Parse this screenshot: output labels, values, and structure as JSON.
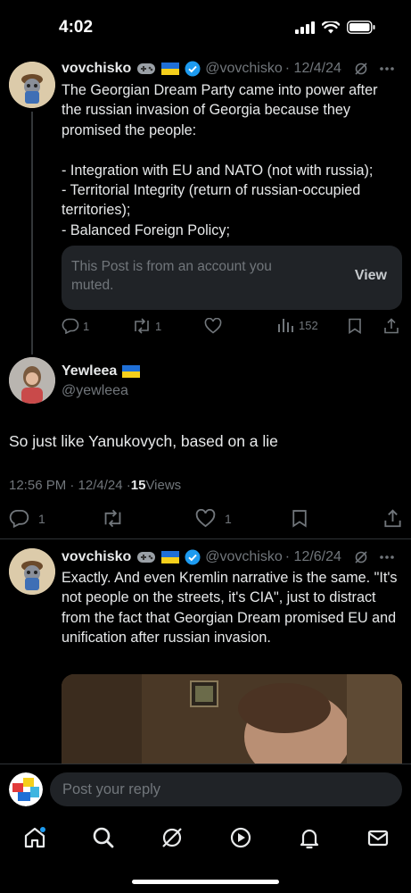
{
  "status_bar": {
    "time": "4:02"
  },
  "tweets": [
    {
      "name": "vovchisko",
      "handle": "@vovchisko",
      "date": "· 12/4/24",
      "body": "The Georgian Dream Party came into power after the russian invasion of Georgia because they promised the people:\n\n- Integration with EU and NATO (not with russia);\n- Territorial Integrity (return of russian-occupied territories);\n- Balanced Foreign Policy;",
      "muted_notice": "This Post is from an account you muted.",
      "muted_view": "View",
      "replies": "1",
      "reposts": "1",
      "views": "152"
    },
    {
      "name": "Yewleea",
      "handle": "@yewleea",
      "body": "So just like Yanukovych, based on a lie",
      "timestamp": "12:56 PM · 12/4/24 · ",
      "views_count": "15",
      "views_label": " Views",
      "replies": "1",
      "likes": "1"
    },
    {
      "name": "vovchisko",
      "handle": "@vovchisko",
      "date": "· 12/6/24",
      "body": "Exactly. And even Kremlin narrative is the same. \"It's not people on the streets, it's CIA\", just to distract from the fact that Georgian Dream promised EU and unification after russian invasion."
    }
  ],
  "reply_bar": {
    "placeholder": "Post your reply"
  },
  "colors": {
    "background": "#000000",
    "text": "#e7e9ea",
    "muted": "#71767b",
    "verified": "#1d9bf0",
    "notification_dot": "#1d9bf0"
  }
}
